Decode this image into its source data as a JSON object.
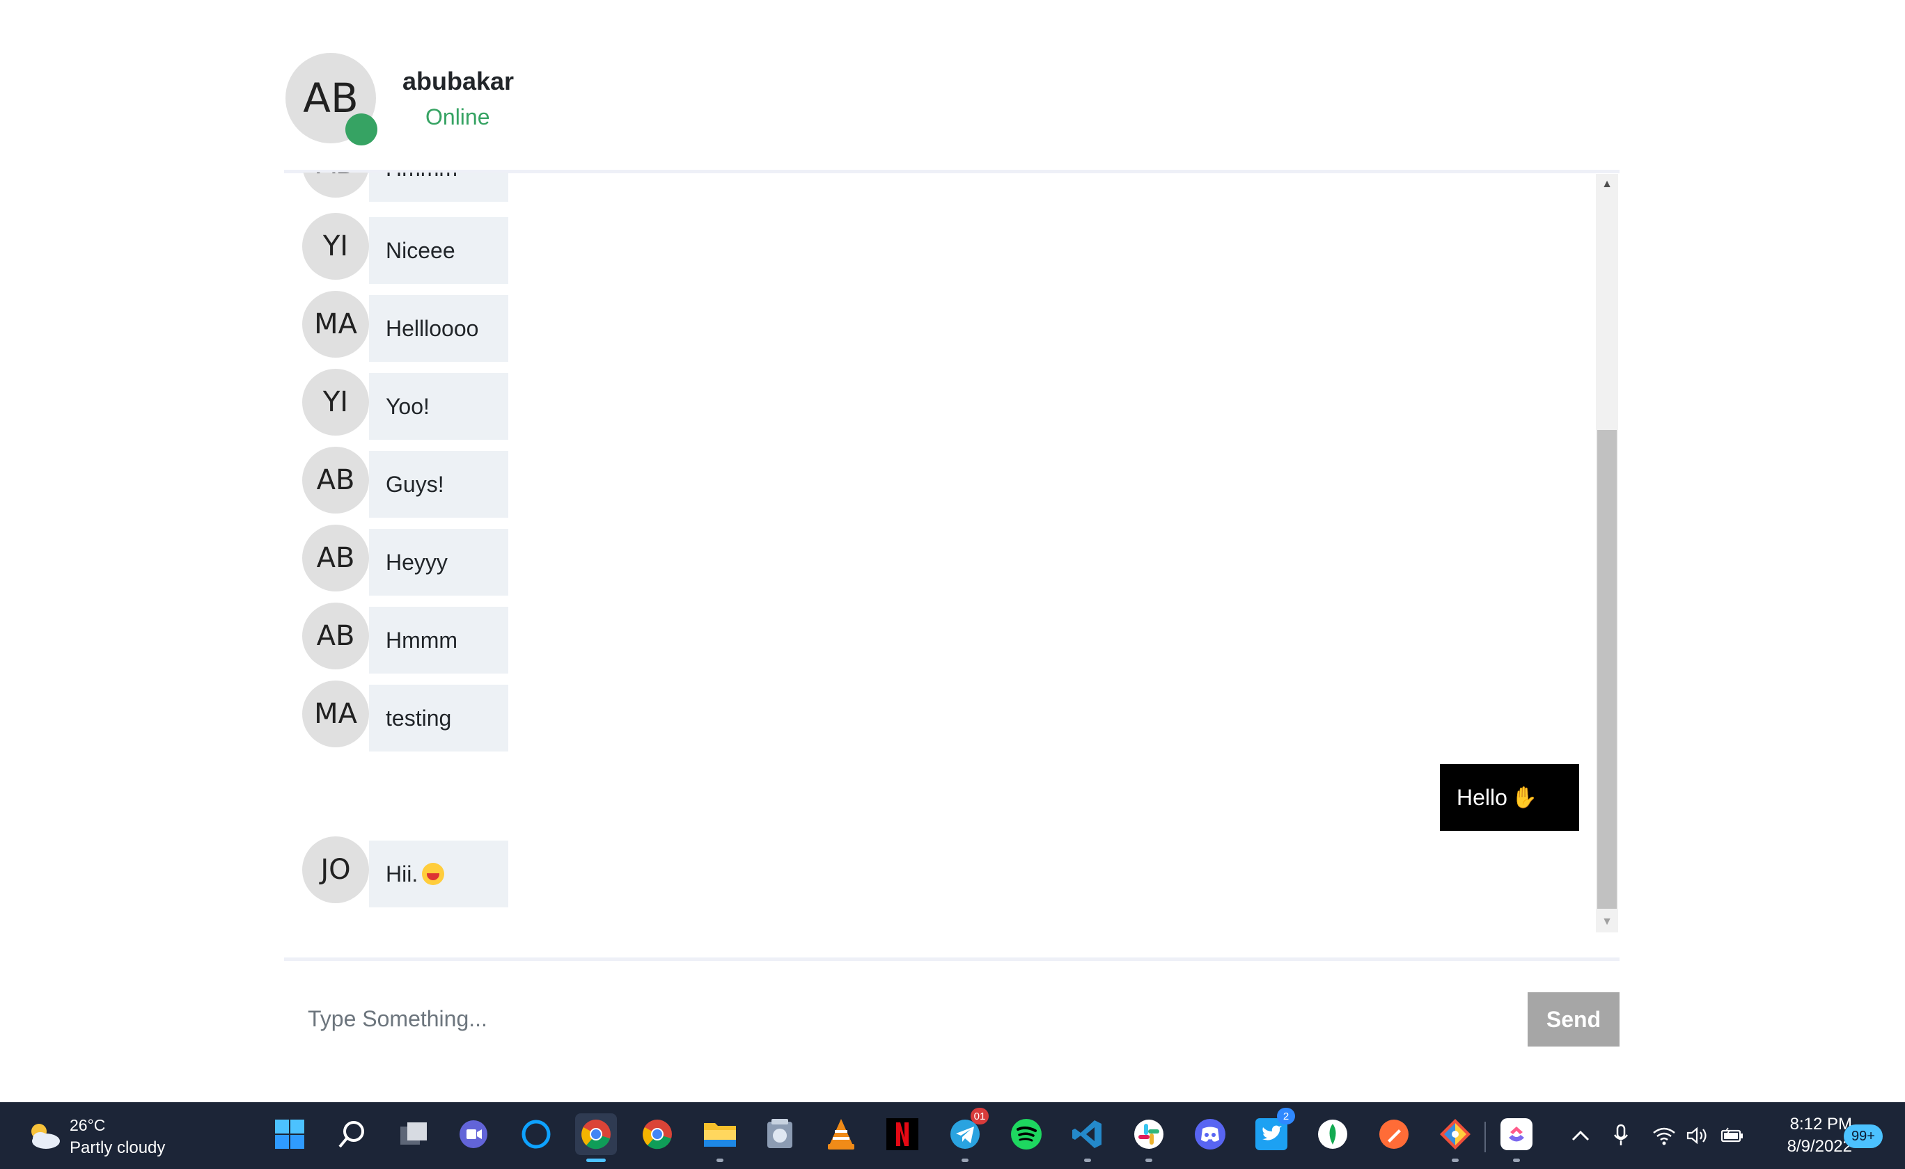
{
  "chat": {
    "user_initials": "AB",
    "user_name": "abubakar",
    "user_status": "Online",
    "colors": {
      "online": "#36a363",
      "bubble_received": "#edf1f5",
      "bubble_sent": "#000000"
    }
  },
  "messages": [
    {
      "initials": "AB",
      "text": "Hmmm",
      "partial": true
    },
    {
      "initials": "YI",
      "text": "Niceee"
    },
    {
      "initials": "MA",
      "text": "Hellloooo"
    },
    {
      "initials": "YI",
      "text": "Yoo!"
    },
    {
      "initials": "AB",
      "text": "Guys!"
    },
    {
      "initials": "AB",
      "text": "Heyyy"
    },
    {
      "initials": "AB",
      "text": "Hmmm"
    },
    {
      "initials": "MA",
      "text": "testing"
    },
    {
      "outgoing": true,
      "text": "Hello",
      "emoji": "waving-hand"
    },
    {
      "initials": "JO",
      "text": "Hii.",
      "emoji": "grinning-face"
    }
  ],
  "composer": {
    "placeholder": "Type Something...",
    "send_label": "Send"
  },
  "taskbar": {
    "weather_temp": "26°C",
    "weather_desc": "Partly cloudy",
    "telegram_badge": "01",
    "twitter_badge": "2",
    "time": "8:12 PM",
    "date": "8/9/2022",
    "notifications": "99+"
  }
}
